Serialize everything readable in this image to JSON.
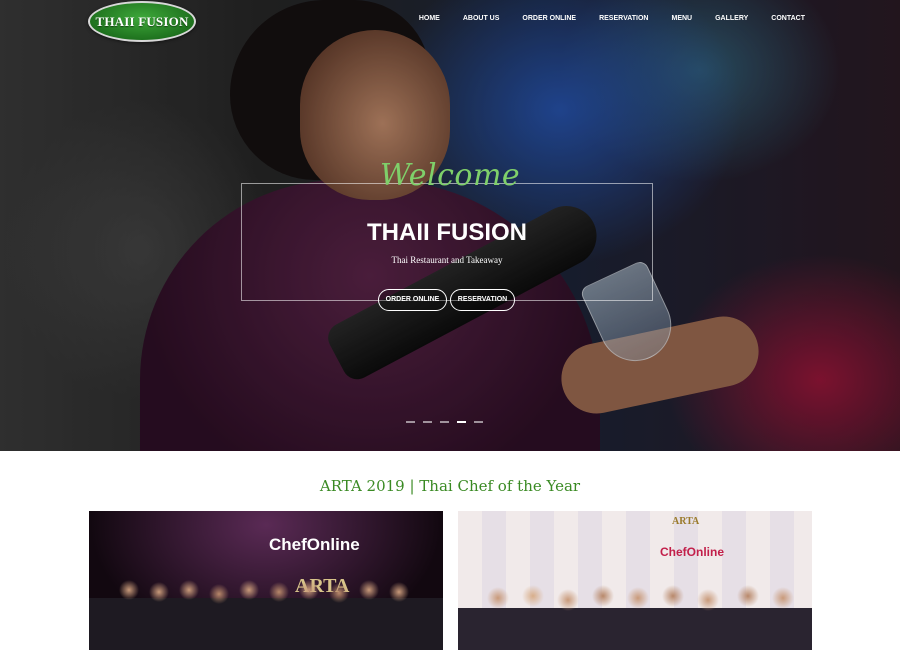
{
  "brand": {
    "logo_text": "THAII FUSION",
    "accent_color": "#3a8a23",
    "script_color": "#7fd06a"
  },
  "nav": {
    "items": [
      {
        "label": "HOME"
      },
      {
        "label": "ABOUT US"
      },
      {
        "label": "ORDER ONLINE"
      },
      {
        "label": "RESERVATION"
      },
      {
        "label": "MENU"
      },
      {
        "label": "GALLERY"
      },
      {
        "label": "CONTACT"
      }
    ]
  },
  "hero": {
    "welcome": "Welcome",
    "title": "THAII FUSION",
    "subtitle": "Thai Restaurant and Takeaway",
    "buttons": {
      "order": "ORDER ONLINE",
      "reservation": "RESERVATION"
    },
    "slider_dots": 5,
    "active_dot": 4
  },
  "section": {
    "title": "ARTA 2019 | Thai Chef of the Year",
    "photos": [
      {
        "banner": "ChefOnline",
        "emblem": "ARTA"
      },
      {
        "banner": "ChefOnline",
        "emblem": "ARTA"
      }
    ]
  }
}
